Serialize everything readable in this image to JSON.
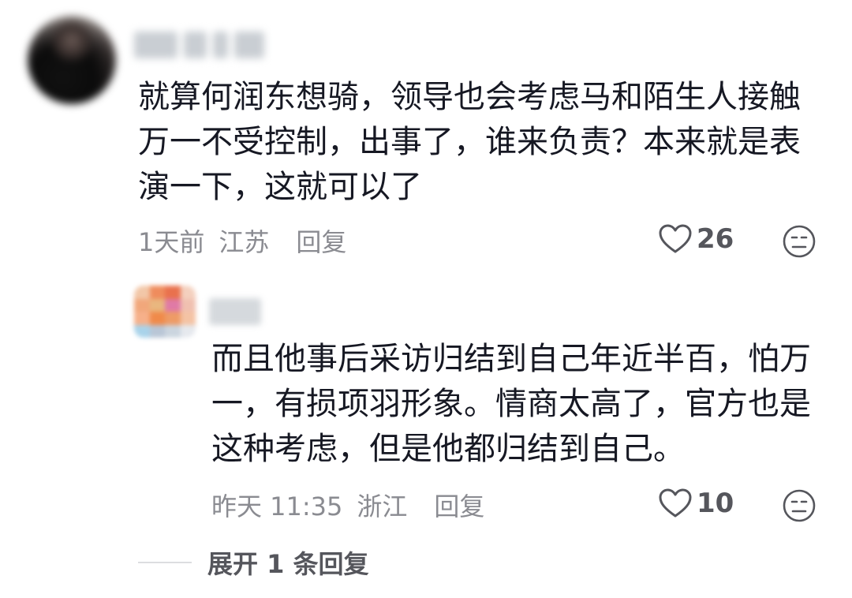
{
  "comment": {
    "lines": [
      "就算何润东想骑，领导也会考虑马和陌生人接触",
      "万一不受控制，出事了，谁来负责？本来就是表",
      "演一下，这就可以了"
    ],
    "time": "1天前",
    "location": "江苏",
    "reply_label": "回复",
    "like_count": "26",
    "like_icon": "heart-outline-icon",
    "dislike_icon": "meh-face-icon"
  },
  "reply": {
    "lines": [
      "而且他事后采访归结到自己年近半百，怕万",
      "一，有损项羽形象。情商太高了，官方也是",
      "这种考虑，但是他都归结到自己。"
    ],
    "time": "昨天 11:35",
    "location": "浙江",
    "reply_label": "回复",
    "like_count": "10",
    "like_icon": "heart-outline-icon",
    "dislike_icon": "meh-face-icon"
  },
  "expand": {
    "label": "展开 1 条回复"
  },
  "colors": {
    "text_primary": "#161823",
    "text_secondary": "#8a8b91",
    "icon": "#55565c"
  }
}
